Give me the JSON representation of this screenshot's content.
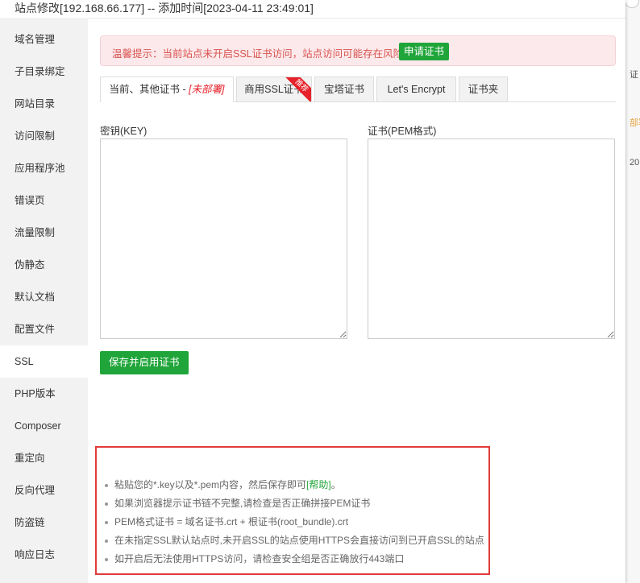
{
  "window": {
    "title": "站点修改[192.168.66.177] -- 添加时间[2023-04-11 23:49:01]"
  },
  "sidebar": {
    "items": [
      {
        "label": "域名管理"
      },
      {
        "label": "子目录绑定"
      },
      {
        "label": "网站目录"
      },
      {
        "label": "访问限制"
      },
      {
        "label": "应用程序池"
      },
      {
        "label": "错误页"
      },
      {
        "label": "流量限制"
      },
      {
        "label": "伪静态"
      },
      {
        "label": "默认文档"
      },
      {
        "label": "配置文件"
      },
      {
        "label": "SSL"
      },
      {
        "label": "PHP版本"
      },
      {
        "label": "Composer"
      },
      {
        "label": "重定向"
      },
      {
        "label": "反向代理"
      },
      {
        "label": "防盗链"
      },
      {
        "label": "响应日志"
      }
    ],
    "active": "SSL"
  },
  "alert": {
    "message": "温馨提示：当前站点未开启SSL证书访问，站点访问可能存在风险。",
    "apply_button": "申请证书"
  },
  "tabs": [
    {
      "label": "当前、其他证书 - ",
      "status": "[未部署]"
    },
    {
      "label": "商用SSL证书",
      "ribbon": "推荐"
    },
    {
      "label": "宝塔证书"
    },
    {
      "label": "Let's Encrypt"
    },
    {
      "label": "证书夹"
    }
  ],
  "form": {
    "key_label": "密钥(KEY)",
    "key_value": "",
    "cert_label": "证书(PEM格式)",
    "cert_value": "",
    "save_button": "保存并启用证书"
  },
  "notes": {
    "item1_prefix": "粘贴您的*.key以及*.pem内容，然后保存即可",
    "item1_help": "[帮助]",
    "item1_suffix": "。",
    "item2": "如果浏览器提示证书链不完整,请检查是否正确拼接PEM证书",
    "item3": "PEM格式证书 = 域名证书.crt + 根证书(root_bundle).crt",
    "item4": "在未指定SSL默认站点时,未开启SSL的站点使用HTTPS会直接访问到已开启SSL的站点",
    "item5": "如开启后无法使用HTTPS访问，请检查安全组是否正确放行443端口"
  },
  "background": {
    "peek1": "证",
    "peek2": "部署",
    "peek3": "20"
  },
  "colors": {
    "accent": "#20a53a",
    "danger": "#e6212a",
    "alert_bg": "#fbe9eb",
    "sidebar_bg": "#f2f2f2"
  }
}
